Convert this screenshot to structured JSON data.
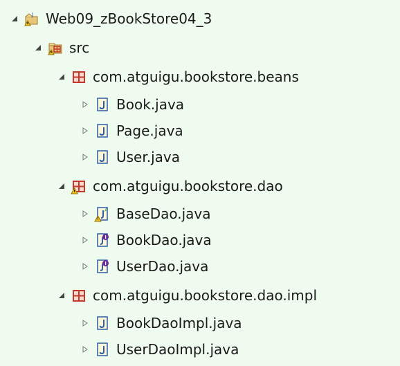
{
  "tree": {
    "project": {
      "label": "Web09_zBookStore04_3",
      "expanded": true,
      "icon": "project-icon"
    },
    "src": {
      "label": "src",
      "expanded": true,
      "icon": "source-folder-icon"
    },
    "packages": [
      {
        "label": "com.atguigu.bookstore.beans",
        "expanded": true,
        "icon": "package-icon",
        "files": [
          {
            "label": "Book.java",
            "icon": "java-class-icon"
          },
          {
            "label": "Page.java",
            "icon": "java-class-icon"
          },
          {
            "label": "User.java",
            "icon": "java-class-icon"
          }
        ]
      },
      {
        "label": "com.atguigu.bookstore.dao",
        "expanded": true,
        "icon": "package-warning-icon",
        "files": [
          {
            "label": "BaseDao.java",
            "icon": "java-abstract-class-warning-icon"
          },
          {
            "label": "BookDao.java",
            "icon": "java-interface-icon"
          },
          {
            "label": "UserDao.java",
            "icon": "java-interface-icon"
          }
        ]
      },
      {
        "label": "com.atguigu.bookstore.dao.impl",
        "expanded": true,
        "icon": "package-icon",
        "files": [
          {
            "label": "BookDaoImpl.java",
            "icon": "java-class-icon"
          },
          {
            "label": "UserDaoImpl.java",
            "icon": "java-class-icon"
          }
        ]
      }
    ]
  },
  "colors": {
    "background": "#f0fbf0",
    "package_red": "#c0392b",
    "java_blue": "#2b5ea7",
    "interface_purple": "#6a2e9a",
    "warning_yellow": "#f5c518",
    "folder_tan": "#e8c679"
  }
}
